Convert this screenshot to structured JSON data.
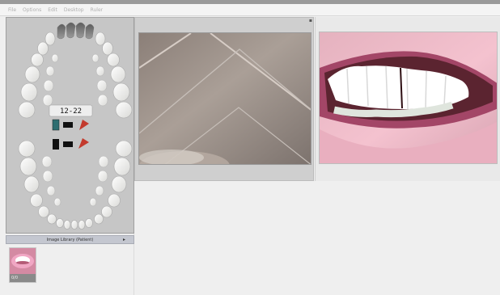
{
  "menu": [
    "File",
    "Options",
    "Edit",
    "Desktop",
    "Ruler"
  ],
  "tooth_chart": {
    "range_label": "12-22"
  },
  "library": {
    "title": "Image Library (Patient)",
    "expand_glyph": "▸"
  },
  "thumbnail": {
    "label": "0/0"
  },
  "colors": {
    "toolbar_strip": "#9a9a9a",
    "panel_gray": "#c6c6c6",
    "library_header": "#c4c7d0",
    "tooth_shade": "#f7f7f4",
    "marker_red": "#c33a2d",
    "marker_teal": "#2d6d70"
  },
  "icons": [
    "tooth-icon",
    "camera-icon",
    "marker-icon",
    "chevron-right-icon"
  ]
}
